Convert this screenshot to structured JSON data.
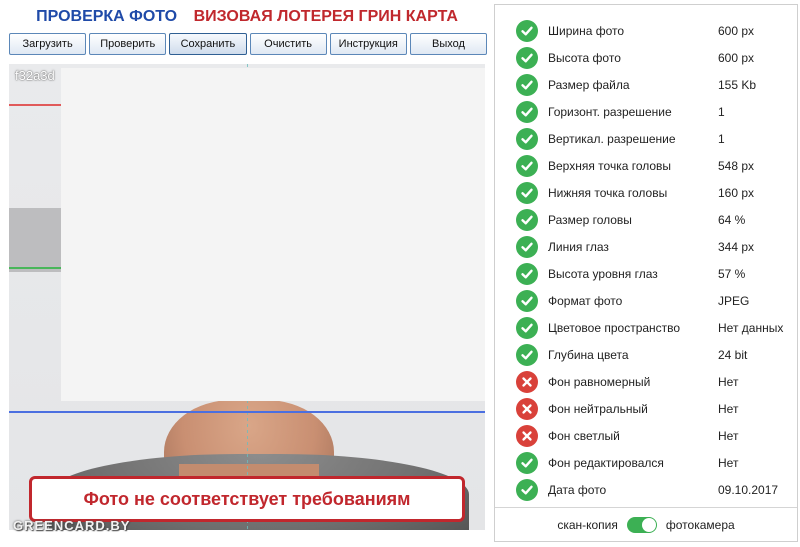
{
  "header": {
    "title_left": "ПРОВЕРКА ФОТО",
    "title_right": "ВИЗОВАЯ ЛОТЕРЕЯ ГРИН КАРТА"
  },
  "toolbar": [
    {
      "label": "Загрузить"
    },
    {
      "label": "Проверить"
    },
    {
      "label": "Сохранить"
    },
    {
      "label": "Очистить"
    },
    {
      "label": "Инструкция"
    },
    {
      "label": "Выход"
    }
  ],
  "photo": {
    "filename": "f32a3d",
    "alert_text": "Фото не соответствует требованиям",
    "watermark": "GREENCARD.BY"
  },
  "checks": [
    {
      "label": "Ширина фото",
      "value": "600 px",
      "status": "ok"
    },
    {
      "label": "Высота фото",
      "value": "600 px",
      "status": "ok"
    },
    {
      "label": "Размер файла",
      "value": "155 Kb",
      "status": "ok"
    },
    {
      "label": "Горизонт. разрешение",
      "value": "1",
      "status": "ok"
    },
    {
      "label": "Вертикал. разрешение",
      "value": "1",
      "status": "ok"
    },
    {
      "label": "Верхняя точка головы",
      "value": "548 px",
      "status": "ok"
    },
    {
      "label": "Нижняя точка головы",
      "value": "160 px",
      "status": "ok"
    },
    {
      "label": "Размер головы",
      "value": "64 %",
      "status": "ok"
    },
    {
      "label": "Линия глаз",
      "value": "344 px",
      "status": "ok"
    },
    {
      "label": "Высота уровня глаз",
      "value": "57 %",
      "status": "ok"
    },
    {
      "label": "Формат фото",
      "value": "JPEG",
      "status": "ok"
    },
    {
      "label": "Цветовое пространство",
      "value": "Нет данных",
      "status": "ok"
    },
    {
      "label": "Глубина цвета",
      "value": "24 bit",
      "status": "ok"
    },
    {
      "label": "Фон равномерный",
      "value": "Нет",
      "status": "bad"
    },
    {
      "label": "Фон нейтральный",
      "value": "Нет",
      "status": "bad"
    },
    {
      "label": "Фон светлый",
      "value": "Нет",
      "status": "bad"
    },
    {
      "label": "Фон редактировался",
      "value": "Нет",
      "status": "ok"
    },
    {
      "label": "Дата фото",
      "value": "09.10.2017",
      "status": "ok"
    }
  ],
  "source_toggle": {
    "left_label": "скан-копия",
    "right_label": "фотокамера",
    "selected": "фотокамера"
  },
  "colors": {
    "ok": "#3cb054",
    "bad": "#d9413a",
    "accent_red": "#c1272d",
    "accent_blue": "#1f4aa8"
  }
}
